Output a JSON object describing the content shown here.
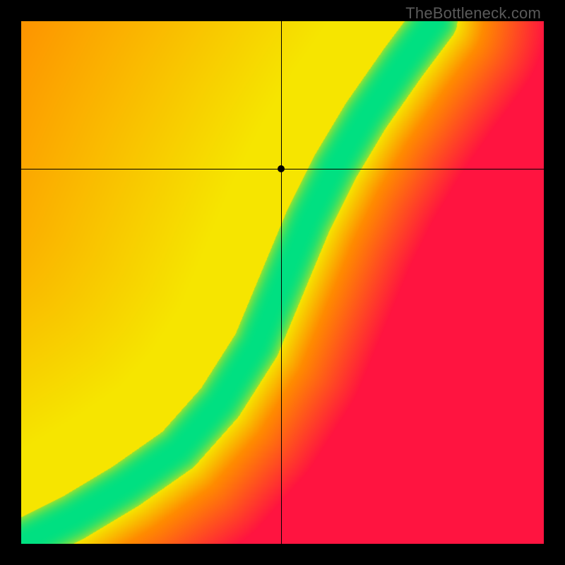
{
  "watermark": "TheBottleneck.com",
  "chart_data": {
    "type": "heatmap",
    "title": "",
    "xlabel": "",
    "ylabel": "",
    "xlim": [
      0,
      1
    ],
    "ylim": [
      0,
      1
    ],
    "crosshair": {
      "x": 0.497,
      "y": 0.717
    },
    "marker": {
      "x": 0.497,
      "y": 0.717
    },
    "optimal_curve": {
      "note": "approximate centerline of the green optimal band (x,y) in normalized [0,1] coords",
      "points": [
        [
          0.0,
          0.0
        ],
        [
          0.1,
          0.05
        ],
        [
          0.2,
          0.11
        ],
        [
          0.3,
          0.18
        ],
        [
          0.38,
          0.27
        ],
        [
          0.45,
          0.38
        ],
        [
          0.5,
          0.5
        ],
        [
          0.55,
          0.62
        ],
        [
          0.6,
          0.72
        ],
        [
          0.66,
          0.82
        ],
        [
          0.73,
          0.92
        ],
        [
          0.79,
          1.0
        ]
      ]
    },
    "band_half_width": 0.045,
    "color_stops": {
      "optimal": "#00e082",
      "near": "#f6e500",
      "mid": "#ff8c00",
      "bad": "#ff1440"
    }
  }
}
